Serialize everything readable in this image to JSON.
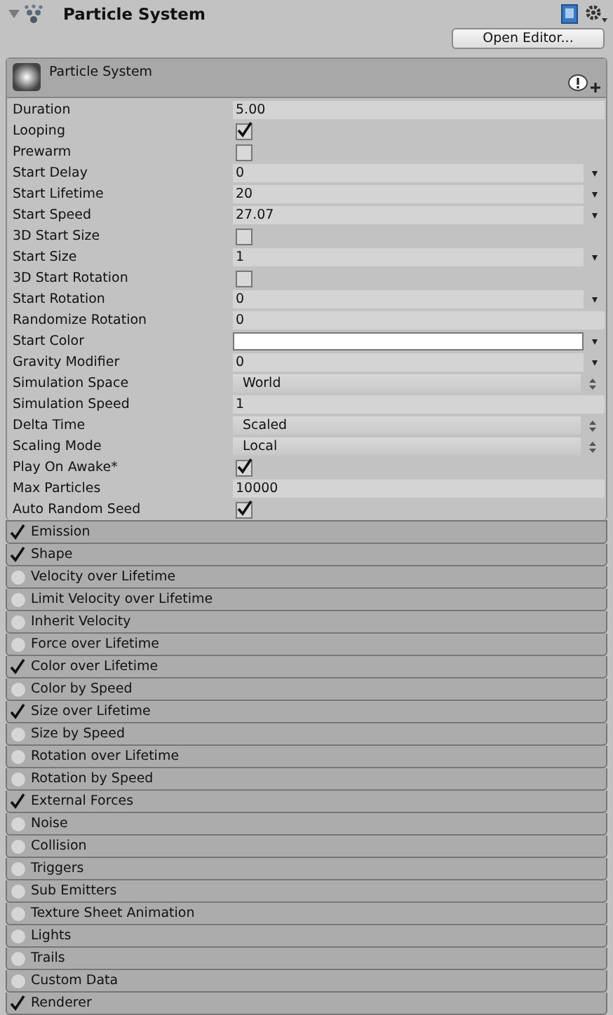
{
  "header": {
    "title": "Particle System",
    "expanded": true,
    "open_editor_button": "Open Editor..."
  },
  "panel": {
    "title": "Particle System"
  },
  "properties": [
    {
      "label": "Duration",
      "kind": "number",
      "value": "5.00"
    },
    {
      "label": "Looping",
      "kind": "checkbox",
      "checked": true
    },
    {
      "label": "Prewarm",
      "kind": "checkbox",
      "checked": false
    },
    {
      "label": "Start Delay",
      "kind": "curve",
      "value": "0"
    },
    {
      "label": "Start Lifetime",
      "kind": "curve",
      "value": "20"
    },
    {
      "label": "Start Speed",
      "kind": "curve",
      "value": "27.07"
    },
    {
      "label": "3D Start Size",
      "kind": "checkbox",
      "checked": false
    },
    {
      "label": "Start Size",
      "kind": "curve",
      "value": "1"
    },
    {
      "label": "3D Start Rotation",
      "kind": "checkbox",
      "checked": false
    },
    {
      "label": "Start Rotation",
      "kind": "curve",
      "value": "0"
    },
    {
      "label": "Randomize Rotation",
      "kind": "number",
      "value": "0"
    },
    {
      "label": "Start Color",
      "kind": "color",
      "color": "#ffffff"
    },
    {
      "label": "Gravity Modifier",
      "kind": "curve",
      "value": "0"
    },
    {
      "label": "Simulation Space",
      "kind": "enum",
      "value": "World"
    },
    {
      "label": "Simulation Speed",
      "kind": "number",
      "value": "1"
    },
    {
      "label": "Delta Time",
      "kind": "enum",
      "value": "Scaled"
    },
    {
      "label": "Scaling Mode",
      "kind": "enum",
      "value": "Local"
    },
    {
      "label": "Play On Awake*",
      "kind": "checkbox",
      "checked": true
    },
    {
      "label": "Max Particles",
      "kind": "number",
      "value": "10000"
    },
    {
      "label": "Auto Random Seed",
      "kind": "checkbox",
      "checked": true
    }
  ],
  "modules": [
    {
      "label": "Emission",
      "enabled": true
    },
    {
      "label": "Shape",
      "enabled": true
    },
    {
      "label": "Velocity over Lifetime",
      "enabled": false
    },
    {
      "label": "Limit Velocity over Lifetime",
      "enabled": false
    },
    {
      "label": "Inherit Velocity",
      "enabled": false
    },
    {
      "label": "Force over Lifetime",
      "enabled": false
    },
    {
      "label": "Color over Lifetime",
      "enabled": true
    },
    {
      "label": "Color by Speed",
      "enabled": false
    },
    {
      "label": "Size over Lifetime",
      "enabled": true
    },
    {
      "label": "Size by Speed",
      "enabled": false
    },
    {
      "label": "Rotation over Lifetime",
      "enabled": false
    },
    {
      "label": "Rotation by Speed",
      "enabled": false
    },
    {
      "label": "External Forces",
      "enabled": true
    },
    {
      "label": "Noise",
      "enabled": false
    },
    {
      "label": "Collision",
      "enabled": false
    },
    {
      "label": "Triggers",
      "enabled": false
    },
    {
      "label": "Sub Emitters",
      "enabled": false
    },
    {
      "label": "Texture Sheet Animation",
      "enabled": false
    },
    {
      "label": "Lights",
      "enabled": false
    },
    {
      "label": "Trails",
      "enabled": false
    },
    {
      "label": "Custom Data",
      "enabled": false
    },
    {
      "label": "Renderer",
      "enabled": true
    }
  ]
}
